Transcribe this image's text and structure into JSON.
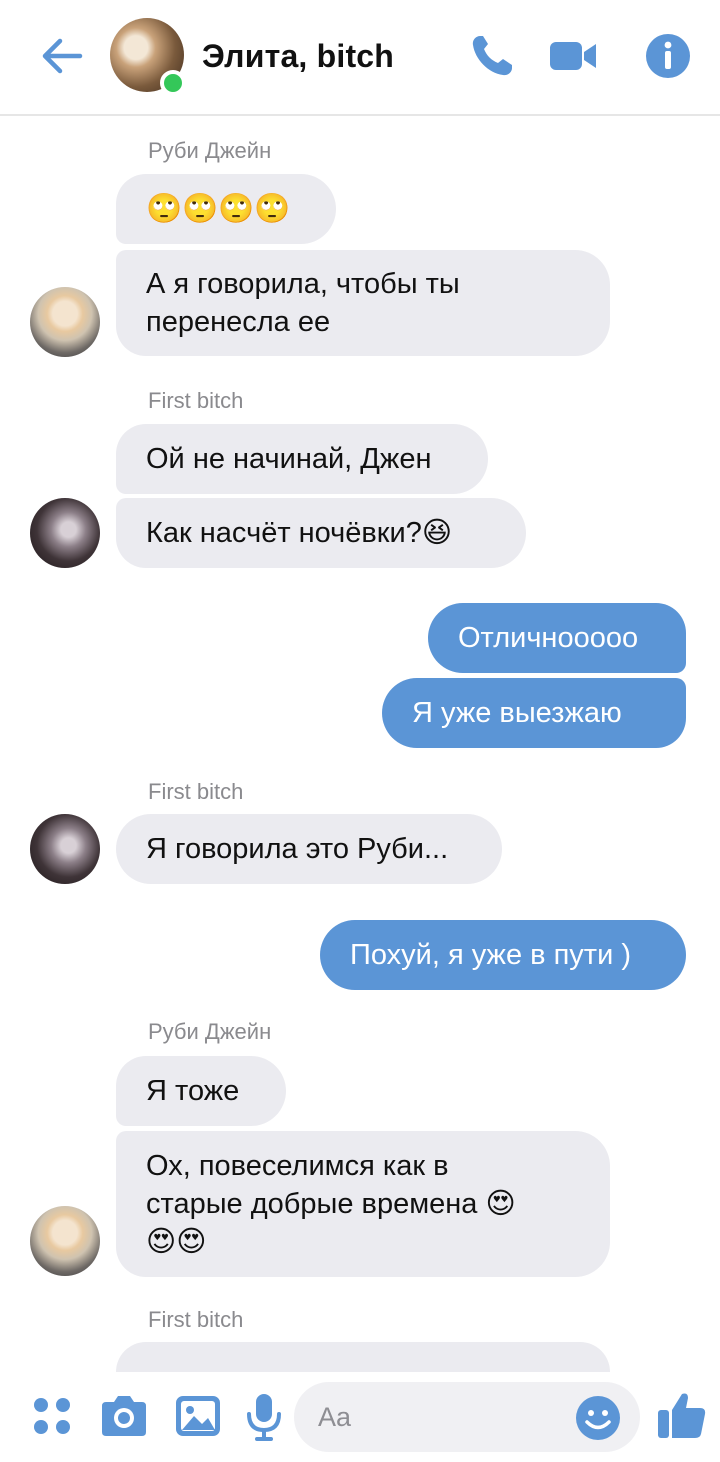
{
  "header": {
    "title": "Элита, bitch",
    "back_icon": "arrow-left-icon",
    "call_icon": "phone-icon",
    "video_icon": "video-camera-icon",
    "info_icon": "info-icon",
    "accent_color": "#5b95d6",
    "online_color": "#34c759"
  },
  "messages": [
    {
      "sender": "Руби Джейн",
      "text": "🙄🙄🙄🙄",
      "direction": "incoming"
    },
    {
      "text_lines": [
        "А я говорила, чтобы ты",
        "перенесла ее"
      ],
      "direction": "incoming"
    },
    {
      "sender": "First bitch",
      "text": "Ой не начинай, Джен",
      "direction": "incoming"
    },
    {
      "text": "Как насчёт ночёвки?😆",
      "direction": "incoming"
    },
    {
      "text": "Отличнооооо",
      "direction": "outgoing"
    },
    {
      "text": "Я уже выезжаю",
      "direction": "outgoing"
    },
    {
      "sender": "First bitch",
      "text": "Я говорила это Руби...",
      "direction": "incoming"
    },
    {
      "text": "Похуй, я уже в пути )",
      "direction": "outgoing"
    },
    {
      "sender": "Руби Джейн",
      "text": "Я тоже",
      "direction": "incoming"
    },
    {
      "text_lines": [
        "Ох, повеселимся как в",
        "старые добрые времена 😍",
        "😍😍"
      ],
      "direction": "incoming"
    },
    {
      "sender": "First bitch",
      "direction": "incoming"
    }
  ],
  "composer": {
    "placeholder": "Aa",
    "icons": [
      "apps-icon",
      "camera-icon",
      "gallery-icon",
      "microphone-icon",
      "emoji-icon",
      "thumbs-up-icon"
    ]
  }
}
